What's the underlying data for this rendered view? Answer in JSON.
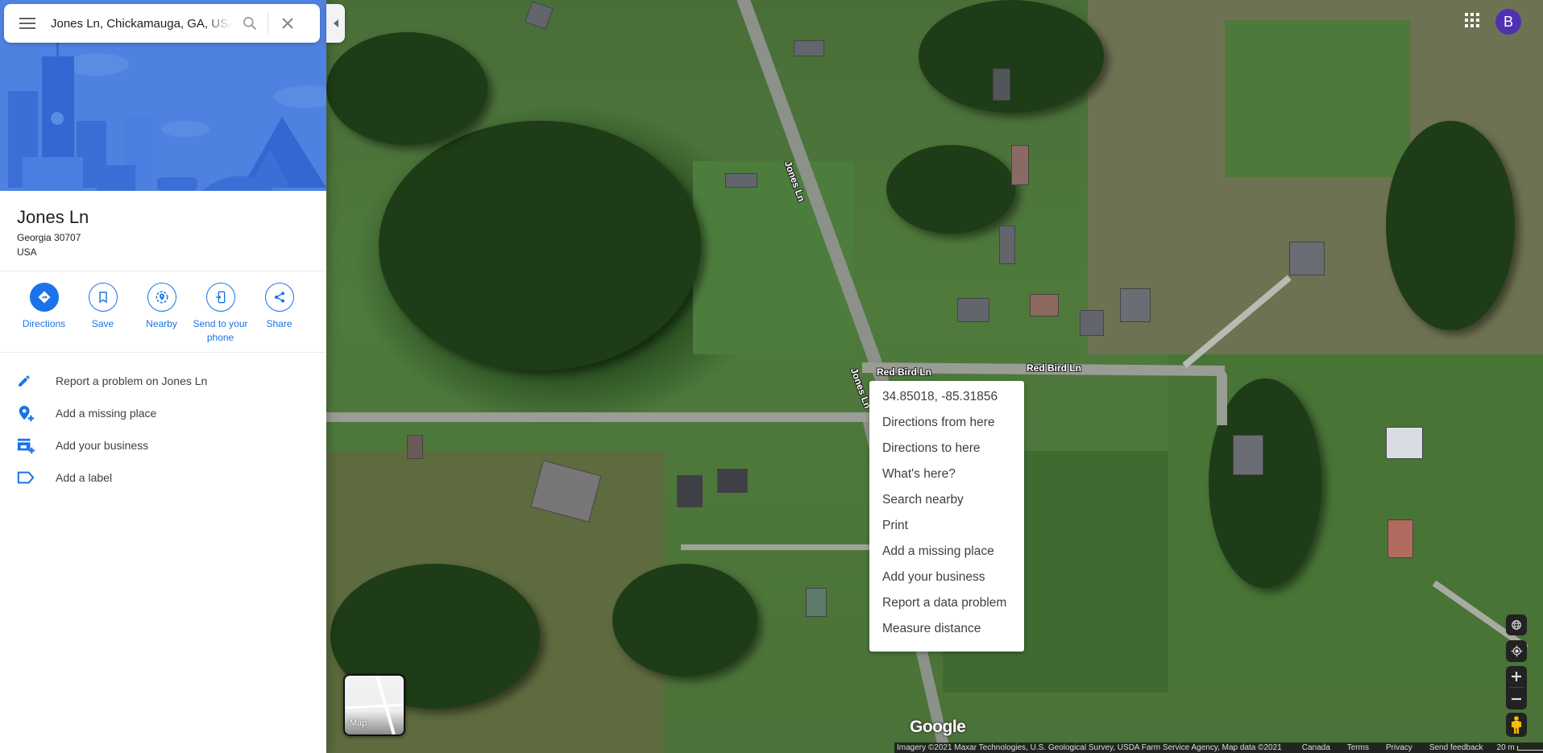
{
  "search": {
    "value": "Jones Ln, Chickamauga, GA, USA",
    "menu_icon": "hamburger-menu-icon",
    "search_icon": "search-icon",
    "clear_icon": "close-icon"
  },
  "place": {
    "title": "Jones Ln",
    "address_line1": "Georgia 30707",
    "address_line2": "USA"
  },
  "actions": [
    {
      "label": "Directions",
      "icon": "directions-icon"
    },
    {
      "label": "Save",
      "icon": "bookmark-icon"
    },
    {
      "label": "Nearby",
      "icon": "nearby-icon"
    },
    {
      "label": "Send to your phone",
      "icon": "send-to-phone-icon"
    },
    {
      "label": "Share",
      "icon": "share-icon"
    }
  ],
  "extras": [
    {
      "label": "Report a problem on Jones Ln",
      "icon": "pencil-icon"
    },
    {
      "label": "Add a missing place",
      "icon": "add-place-icon"
    },
    {
      "label": "Add your business",
      "icon": "add-business-icon"
    },
    {
      "label": "Add a label",
      "icon": "label-icon"
    }
  ],
  "account": {
    "avatar_letter": "B",
    "avatar_color": "#5130b4"
  },
  "map": {
    "road_labels": [
      "Jones Ln",
      "Jones Ln",
      "Red Bird Ln",
      "Red Bird Ln"
    ],
    "layer_toggle_label": "Map",
    "logo": "Google",
    "attribution": "Imagery ©2021 Maxar Technologies, U.S. Geological Survey, USDA Farm Service Agency, Map data ©2021",
    "footer_links": [
      "Canada",
      "Terms",
      "Privacy",
      "Send feedback"
    ],
    "scale_label": "20 m"
  },
  "context_menu": {
    "items": [
      "34.85018, -85.31856",
      "Directions from here",
      "Directions to here",
      "What's here?",
      "Search nearby",
      "Print",
      "Add a missing place",
      "Add your business",
      "Report a data problem",
      "Measure distance"
    ]
  },
  "colors": {
    "accent": "#1a73e8",
    "hero_bg": "#4f82e0"
  }
}
